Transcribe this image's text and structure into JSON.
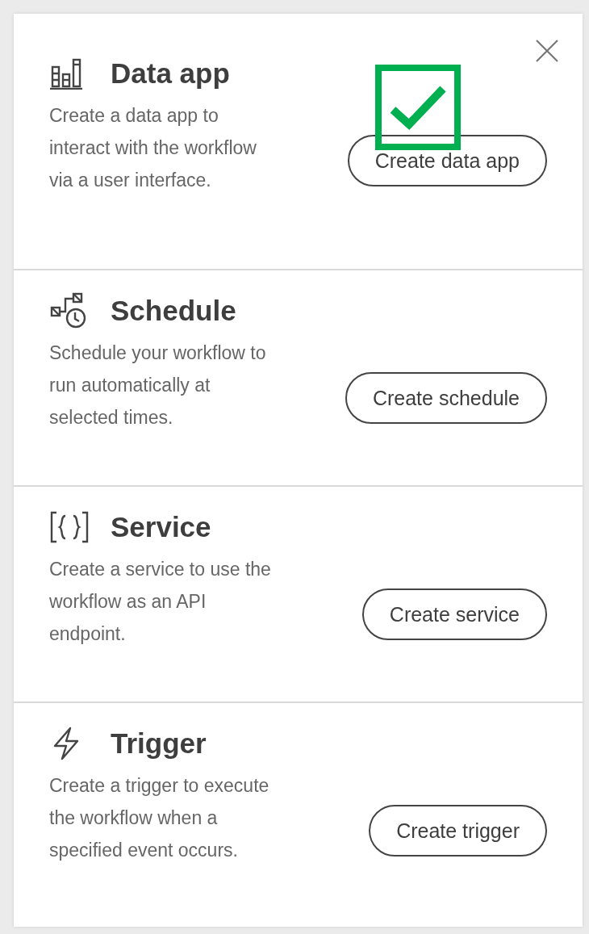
{
  "sections": [
    {
      "title": "Data app",
      "description": "Create a data app to interact with the workflow via a user interface.",
      "button": "Create data app"
    },
    {
      "title": "Schedule",
      "description": "Schedule your workflow to run automatically at selected times.",
      "button": "Create schedule"
    },
    {
      "title": "Service",
      "description": "Create a service to use the workflow as an API endpoint.",
      "button": "Create service"
    },
    {
      "title": "Trigger",
      "description": "Create a trigger to execute the workflow when a specified event occurs.",
      "button": "Create trigger"
    }
  ]
}
